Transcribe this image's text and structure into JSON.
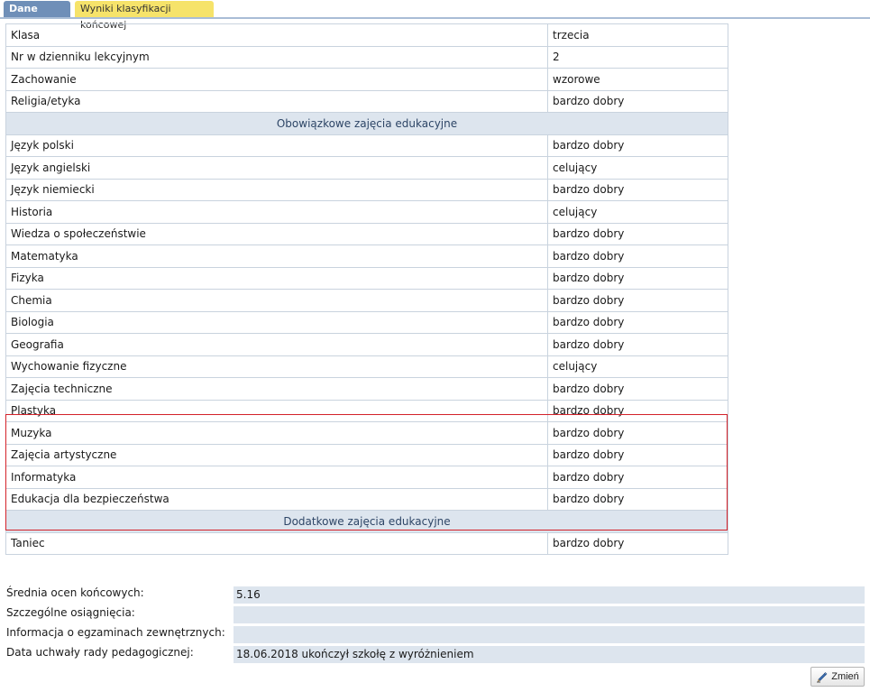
{
  "tabs": [
    {
      "label": "Dane ucznia"
    },
    {
      "label": "Wyniki klasyfikacji końcowej"
    }
  ],
  "info_rows": [
    {
      "label": "Klasa",
      "value": "trzecia"
    },
    {
      "label": "Nr w dzienniku lekcyjnym",
      "value": "2"
    },
    {
      "label": "Zachowanie",
      "value": "wzorowe"
    },
    {
      "label": "Religia/etyka",
      "value": "bardzo dobry"
    }
  ],
  "mandatory_section": {
    "title": "Obowiązkowe zajęcia edukacyjne",
    "rows": [
      {
        "label": "Język polski",
        "value": "bardzo dobry"
      },
      {
        "label": "Język angielski",
        "value": "celujący"
      },
      {
        "label": "Język niemiecki",
        "value": "bardzo dobry"
      },
      {
        "label": "Historia",
        "value": "celujący"
      },
      {
        "label": "Wiedza o społeczeństwie",
        "value": "bardzo dobry"
      },
      {
        "label": "Matematyka",
        "value": "bardzo dobry"
      },
      {
        "label": "Fizyka",
        "value": "bardzo dobry"
      },
      {
        "label": "Chemia",
        "value": "bardzo dobry"
      },
      {
        "label": "Biologia",
        "value": "bardzo dobry"
      },
      {
        "label": "Geografia",
        "value": "bardzo dobry"
      },
      {
        "label": "Wychowanie fizyczne",
        "value": "celujący"
      },
      {
        "label": "Zajęcia techniczne",
        "value": "bardzo dobry"
      },
      {
        "label": "Plastyka",
        "value": "bardzo dobry"
      },
      {
        "label": "Muzyka",
        "value": "bardzo dobry"
      },
      {
        "label": "Zajęcia artystyczne",
        "value": "bardzo dobry"
      },
      {
        "label": "Informatyka",
        "value": "bardzo dobry"
      },
      {
        "label": "Edukacja dla bezpieczeństwa",
        "value": "bardzo dobry"
      }
    ]
  },
  "additional_section": {
    "title": "Dodatkowe zajęcia edukacyjne",
    "rows": [
      {
        "label": "Taniec",
        "value": "bardzo dobry"
      }
    ]
  },
  "summary": {
    "average_label": "Średnia ocen końcowych:",
    "average_value": "5.16",
    "achievements_label": "Szczególne osiągnięcia:",
    "achievements_value": "",
    "exams_label": "Informacja o egzaminach zewnętrznych:",
    "exams_value": "",
    "resolution_label": "Data uchwały rady pedagogicznej:",
    "resolution_value": "18.06.2018 ukończył szkołę z wyróżnieniem"
  },
  "buttons": {
    "change_label": "Zmień",
    "change_icon": "pencil-icon"
  },
  "colors": {
    "tab_active": "#6f8fb8",
    "tab_results": "#f6e36a",
    "section_bg": "#dde5ee",
    "highlight_border": "#d4222a"
  }
}
